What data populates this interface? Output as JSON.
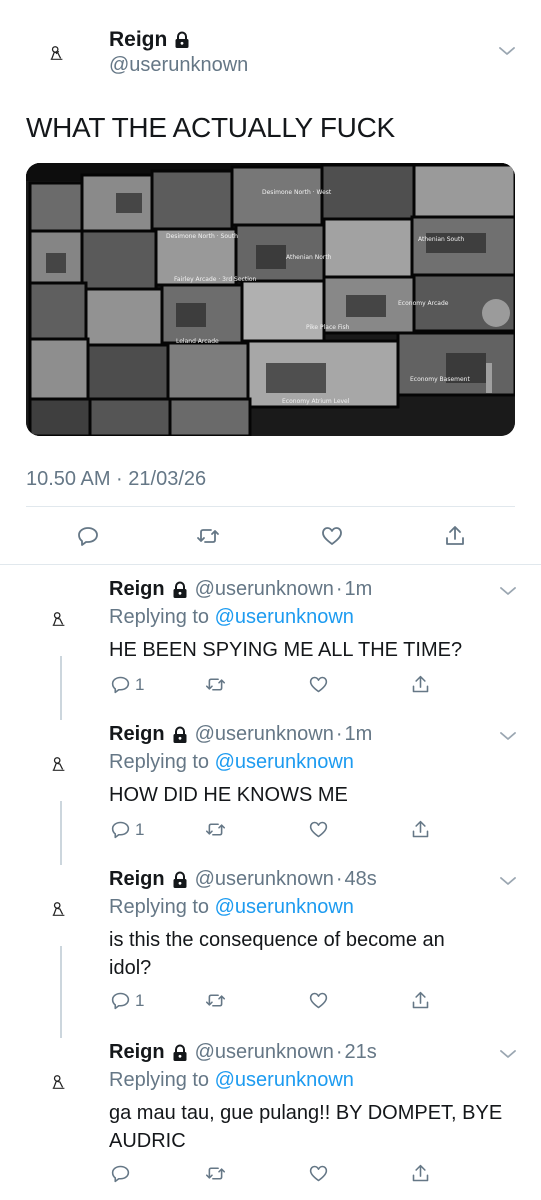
{
  "main_tweet": {
    "author_name": "Reign",
    "handle": "@userunknown",
    "text": "WHAT THE ACTUALLY FUCK",
    "timestamp": "10.50 AM · 21/03/26",
    "media_labels": {
      "desimone_north_west": "Desimone North · West",
      "desimone_north_south": "Desimone North · South",
      "athenian_north": "Athenian North",
      "athenian_south": "Athenian South",
      "economy_arcade": "Economy Arcade",
      "pike_place_fish": "Pike Place Fish",
      "economy_atrium_level": "Economy Atrium Level",
      "economy_basement": "Economy Basement",
      "fairley_arcade": "Fairley Arcade · 3rd Section",
      "leland_arcade": "Leland Arcade"
    }
  },
  "replies": [
    {
      "author_name": "Reign",
      "handle": "@userunknown",
      "sep": "·",
      "time": "1m",
      "replying_prefix": "Replying to",
      "replying_to": "@userunknown",
      "text": "HE BEEN SPYING ME ALL THE TIME?",
      "reply_count": "1"
    },
    {
      "author_name": "Reign",
      "handle": "@userunknown",
      "sep": "·",
      "time": "1m",
      "replying_prefix": "Replying to",
      "replying_to": "@userunknown",
      "text": "HOW DID HE KNOWS ME",
      "reply_count": "1"
    },
    {
      "author_name": "Reign",
      "handle": "@userunknown",
      "sep": "·",
      "time": "48s",
      "replying_prefix": "Replying to",
      "replying_to": "@userunknown",
      "text": "is this the consequence of become an idol?",
      "reply_count": "1"
    },
    {
      "author_name": "Reign",
      "handle": "@userunknown",
      "sep": "·",
      "time": "21s",
      "replying_prefix": "Replying to",
      "replying_to": "@userunknown",
      "text": "ga mau tau, gue pulang!! BY DOMPET, BYE AUDRIC",
      "reply_count": ""
    }
  ],
  "icons": {
    "reply": "reply-icon",
    "retweet": "retweet-icon",
    "like": "heart-icon",
    "share": "share-icon",
    "lock": "lock-icon",
    "more": "chevron-down-icon"
  },
  "colors": {
    "link": "#1d9bf0",
    "secondary": "#657786",
    "divider": "#e1e8ed",
    "text": "#14171a"
  }
}
